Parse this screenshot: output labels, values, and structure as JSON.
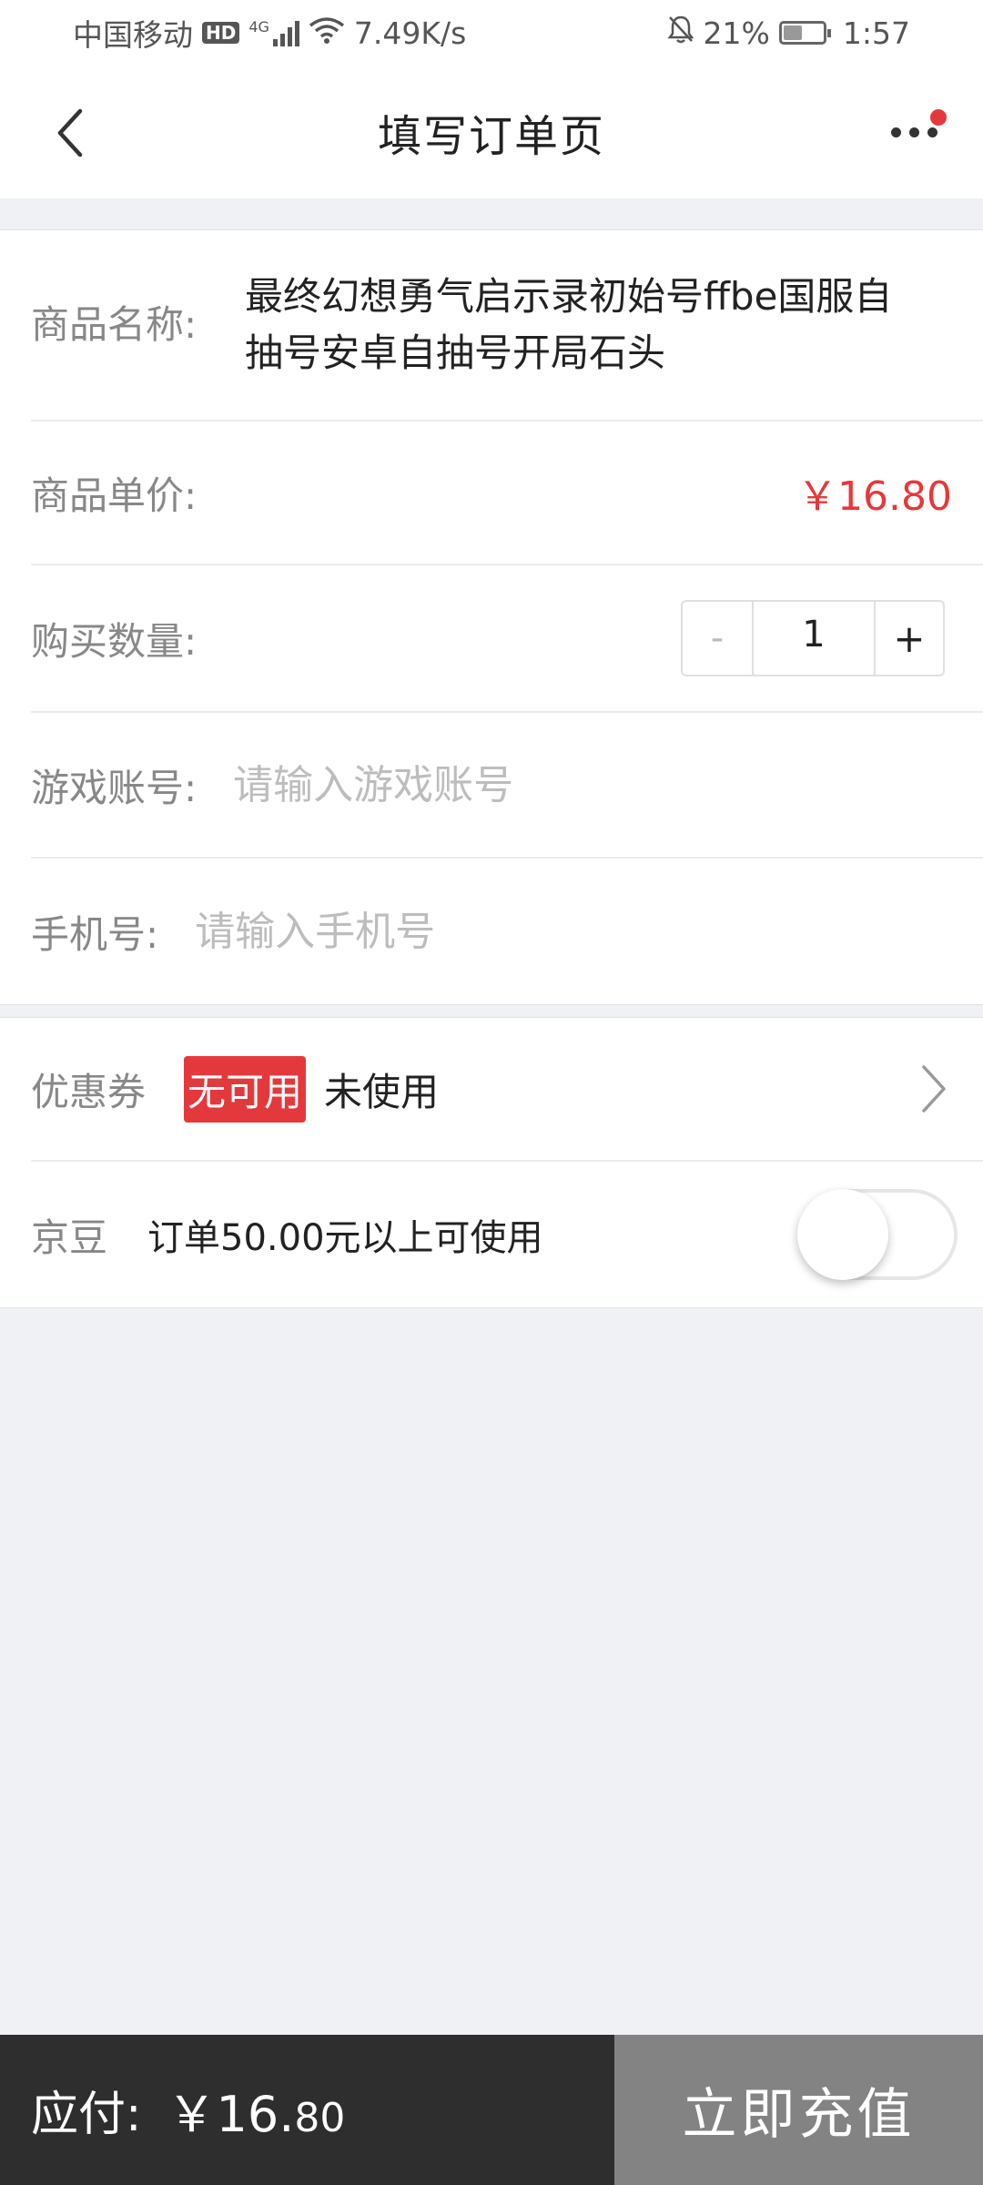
{
  "status_bar": {
    "carrier": "中国移动",
    "hd": "HD",
    "network": "4G",
    "speed": "7.49K/s",
    "battery": "21%",
    "time": "1:57"
  },
  "nav": {
    "title": "填写订单页",
    "back_icon": "chevron-left-icon",
    "more_icon": "more-dots-icon"
  },
  "order": {
    "name_label": "商品名称:",
    "name_value": "最终幻想勇气启示录初始号ffbe国服自抽号安卓自抽号开局石头",
    "price_label": "商品单价:",
    "price_value": "￥16.80",
    "qty_label": "购买数量:",
    "qty_minus": "-",
    "qty_value": "1",
    "qty_plus": "+",
    "account_label": "游戏账号:",
    "account_placeholder": "请输入游戏账号",
    "phone_label": "手机号:",
    "phone_placeholder": "请输入手机号"
  },
  "discounts": {
    "coupon_label": "优惠券",
    "coupon_badge": "无可用",
    "coupon_status": "未使用",
    "bean_label": "京豆",
    "bean_desc": "订单50.00元以上可使用"
  },
  "footer": {
    "pay_label": "应付:",
    "pay_amount_main": "￥16.",
    "pay_amount_cents": "80",
    "submit_label": "立即充值"
  },
  "colors": {
    "accent": "#e4393c",
    "footer_dark": "#2e2e2e",
    "footer_button": "#838383"
  }
}
